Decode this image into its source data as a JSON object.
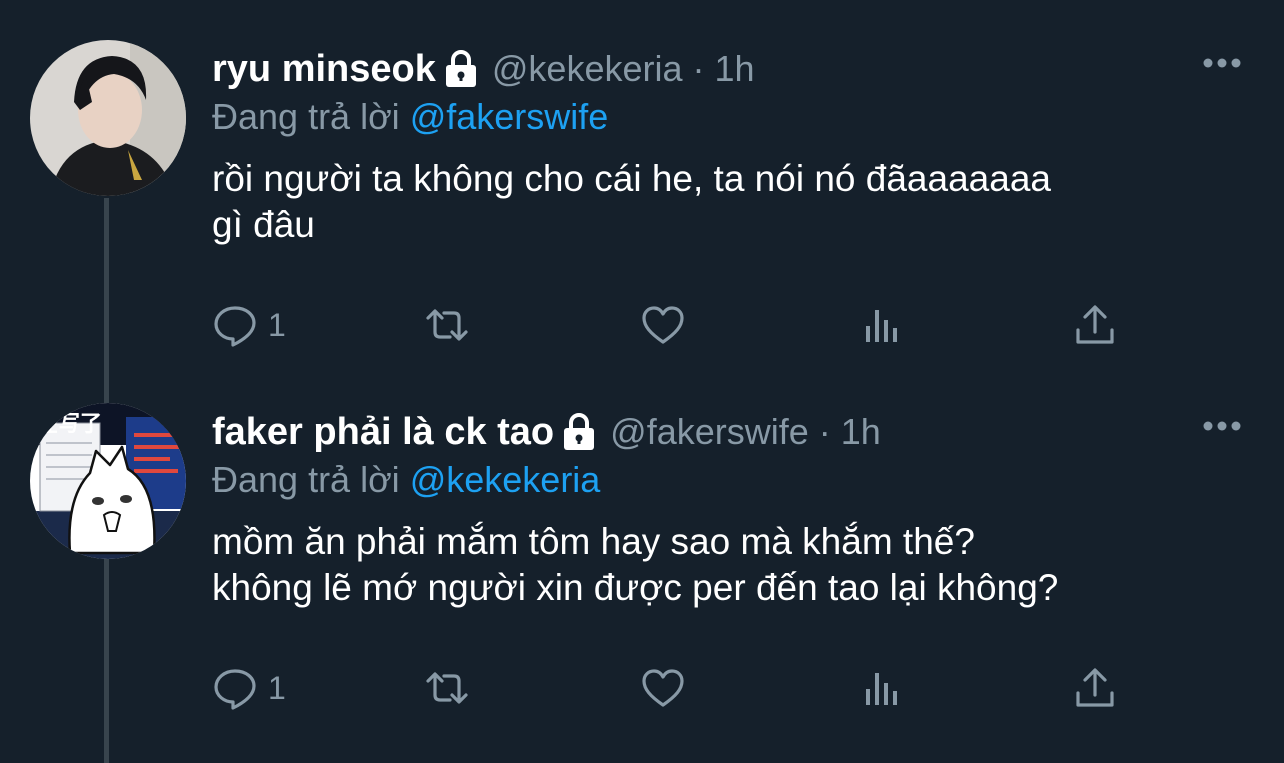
{
  "tweets": [
    {
      "display_name": "ryu minseok",
      "handle": "@kekekeria",
      "separator": "·",
      "time": "1h",
      "reply_prefix": "Đang trả lời",
      "reply_to": "@fakerswife",
      "text_lines": [
        "rồi người ta không cho cái he, ta nói nó đãaaaaaaa",
        "gì đâu"
      ],
      "reply_count": "1",
      "icons": [
        "lock-icon",
        "more-icon",
        "reply-icon",
        "retweet-icon",
        "like-icon",
        "views-icon",
        "share-icon"
      ]
    },
    {
      "display_name": "faker phải là ck tao",
      "handle": "@fakerswife",
      "separator": "·",
      "time": "1h",
      "reply_prefix": "Đang trả lời",
      "reply_to": "@kekekeria",
      "text_lines": [
        "mồm ăn phải mắm tôm hay sao mà khắm thế?",
        "không lẽ mớ người xin được per đến tao lại không?"
      ],
      "reply_count": "1",
      "avatar_text": "在写了",
      "icons": [
        "lock-icon",
        "more-icon",
        "reply-icon",
        "retweet-icon",
        "like-icon",
        "views-icon",
        "share-icon"
      ]
    }
  ],
  "colors": {
    "background": "#15202b",
    "primary_text": "#ffffff",
    "secondary_text": "#8899a6",
    "accent": "#1da1f2",
    "thread_line": "#38444d"
  }
}
